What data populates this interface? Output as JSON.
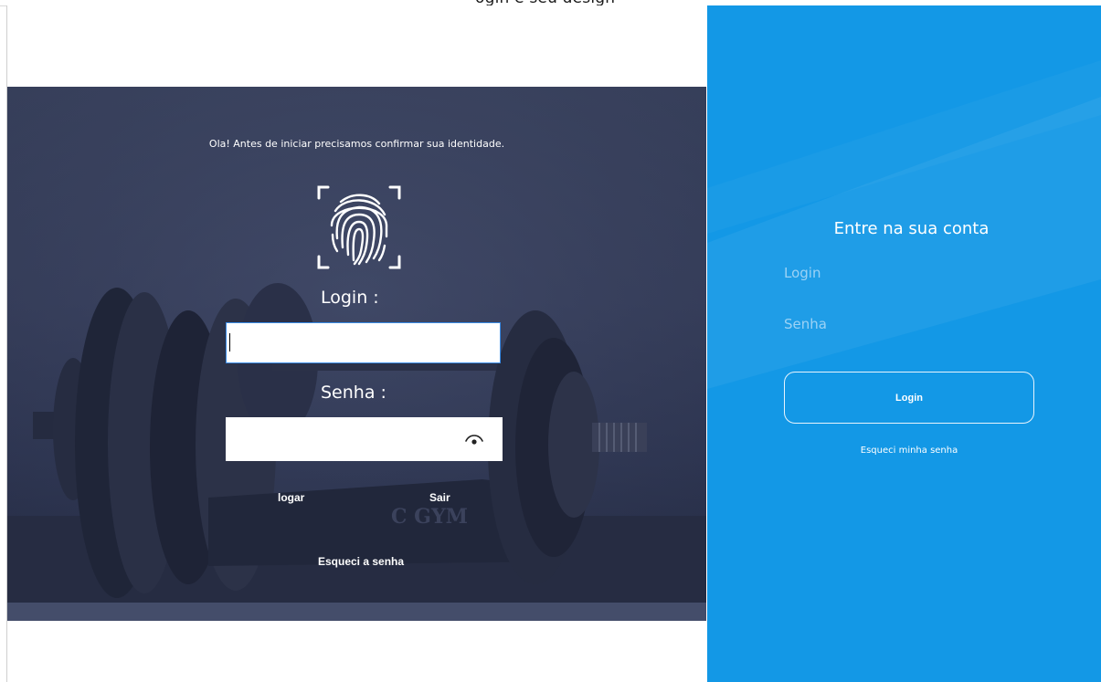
{
  "header": {
    "partial_title": "ogin  e  seu  design"
  },
  "left_panel": {
    "greeting": "Ola! Antes de iniciar precisamos confirmar sua identidade.",
    "login_label": "Login :",
    "login_value": "",
    "senha_label": "Senha :",
    "senha_value": "",
    "logar_button": "logar",
    "sair_button": "Sair",
    "forgot_button": "Esqueci a senha",
    "background_text": "C GYM",
    "fingerprint_icon": "fingerprint-icon",
    "password_toggle_icon": "eye-icon"
  },
  "right_panel": {
    "title": "Entre na sua conta",
    "login_placeholder": "Login",
    "senha_placeholder": "Senha",
    "login_button": "Login",
    "forgot_link": "Esqueci minha senha"
  },
  "colors": {
    "right_panel_blue": "#1398e6",
    "hero_overlay": "#3e4764",
    "input_focus_border": "#3a8ce6"
  }
}
